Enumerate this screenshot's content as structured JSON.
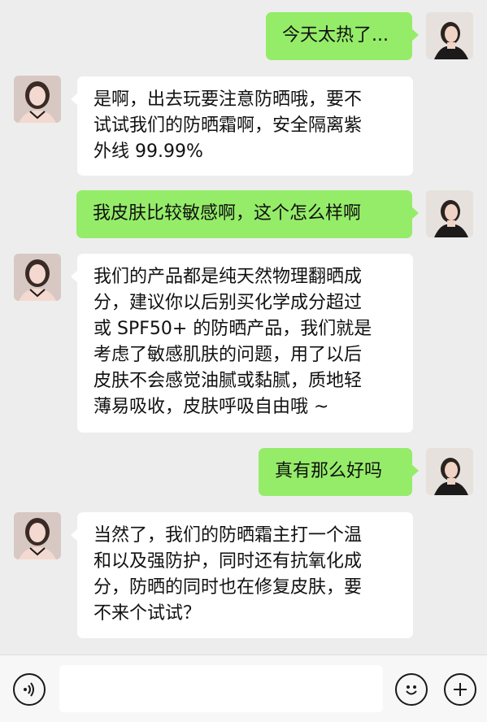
{
  "messages": [
    {
      "side": "right",
      "sender": "me",
      "text": "今天太热了..."
    },
    {
      "side": "left",
      "sender": "contact",
      "text": "是啊，出去玩要注意防晒哦，要不\n试试我们的防晒霜啊，安全隔离紫\n外线 99.99%"
    },
    {
      "side": "right",
      "sender": "me",
      "text": "我皮肤比较敏感啊，这个怎么样啊"
    },
    {
      "side": "left",
      "sender": "contact",
      "text": "我们的产品都是纯天然物理翻晒成\n分，建议你以后别买化学成分超过\n或 SPF50+ 的防晒产品，我们就是\n考虑了敏感肌肤的问题，用了以后\n皮肤不会感觉油腻或黏腻，质地轻\n薄易吸收，皮肤呼吸自由哦 ~"
    },
    {
      "side": "right",
      "sender": "me",
      "text": "真有那么好吗"
    },
    {
      "side": "left",
      "sender": "contact",
      "text": "当然了，我们的防晒霜主打一个温\n和以及强防护，同时还有抗氧化成\n分，防晒的同时也在修复皮肤，要\n不来个试试？"
    }
  ],
  "input_bar": {
    "voice_icon": "voice-icon",
    "emoji_icon": "emoji-icon",
    "plus_icon": "plus-icon",
    "input_value": "",
    "input_placeholder": ""
  },
  "colors": {
    "background": "#ededed",
    "outgoing_bubble": "#95ec69",
    "incoming_bubble": "#ffffff",
    "bottom_bar": "#f7f7f7"
  }
}
